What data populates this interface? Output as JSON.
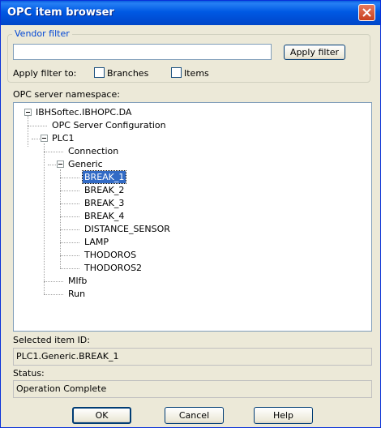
{
  "window": {
    "title": "OPC item browser"
  },
  "vendor_filter": {
    "group_label": "Vendor filter",
    "input_value": "",
    "apply_button": "Apply filter",
    "apply_to_label": "Apply filter to:",
    "branches_label": "Branches",
    "branches_checked": false,
    "items_label": "Items",
    "items_checked": false
  },
  "namespace": {
    "label": "OPC server namespace:",
    "tree": {
      "root": "IBHSoftec.IBHOPC.DA",
      "opc_config": "OPC Server Configuration",
      "plc1": "PLC1",
      "connection": "Connection",
      "generic": "Generic",
      "items": [
        "BREAK_1",
        "BREAK_2",
        "BREAK_3",
        "BREAK_4",
        "DISTANCE_SENSOR",
        "LAMP",
        "THODOROS",
        "THODOROS2"
      ],
      "mlfb": "Mlfb",
      "run": "Run"
    },
    "selected_item": "BREAK_1"
  },
  "selected_item_id": {
    "label": "Selected item ID:",
    "value": "PLC1.Generic.BREAK_1"
  },
  "status": {
    "label": "Status:",
    "value": "Operation Complete"
  },
  "buttons": {
    "ok": "OK",
    "cancel": "Cancel",
    "help": "Help"
  }
}
